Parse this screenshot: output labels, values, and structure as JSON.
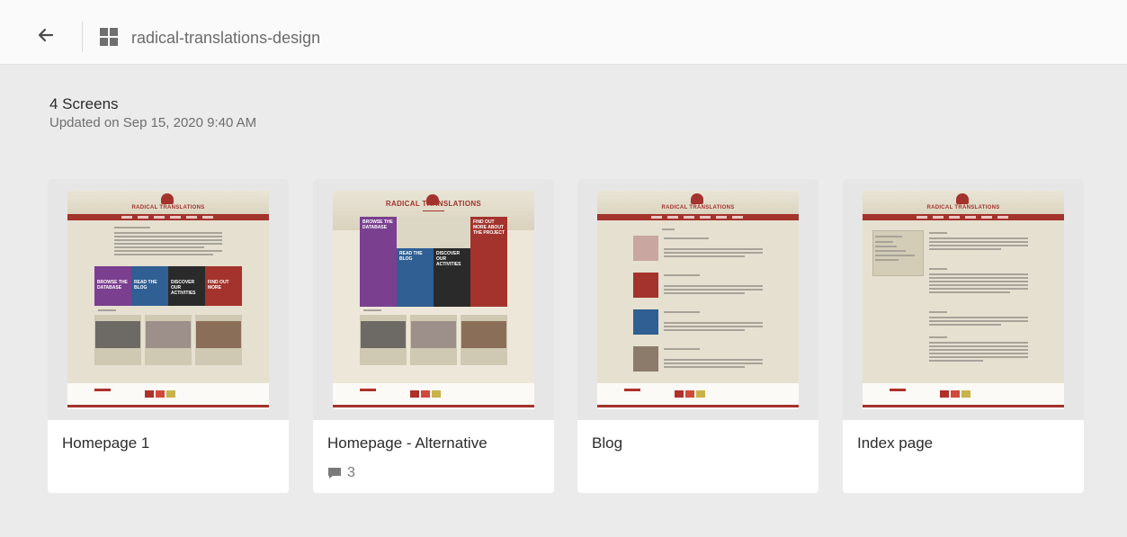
{
  "header": {
    "back_icon": "back-arrow-icon",
    "project_icon": "grid-icon",
    "project_name": "radical-translations-design"
  },
  "summary": {
    "screen_count": "4 Screens",
    "updated": "Updated on Sep 15, 2020 9:40 AM"
  },
  "cards": [
    {
      "title": "Homepage 1"
    },
    {
      "title": "Homepage - Alternative",
      "comment_count": "3",
      "comment_icon": "comment-icon"
    },
    {
      "title": "Blog"
    },
    {
      "title": "Index page"
    }
  ],
  "thumbnail_brand": "RADICAL TRANSLATIONS",
  "colors": {
    "accent_red": "#a3332c",
    "purple": "#7a3f8e",
    "blue": "#2f5f93",
    "black": "#2a2a2a"
  }
}
